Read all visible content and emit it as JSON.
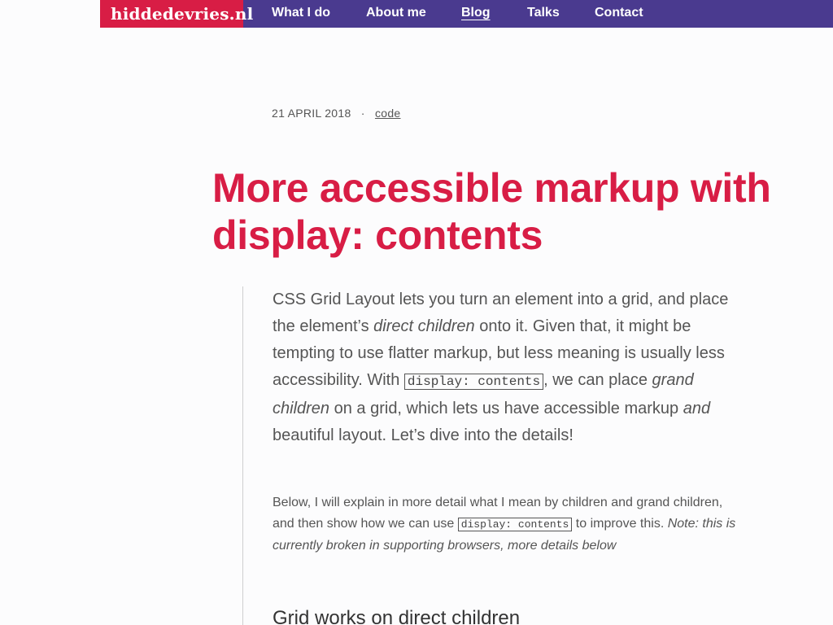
{
  "header": {
    "logo": "hiddedevries.nl",
    "nav": [
      "What I do",
      "About me",
      "Blog",
      "Talks",
      "Contact"
    ],
    "active": "Blog"
  },
  "post": {
    "date": "21 APRIL 2018",
    "separator": "·",
    "category": "code",
    "title": "More accessible markup with display: contents",
    "intro": [
      "CSS Grid Layout lets you turn an element into a grid, and place the element’s ",
      "direct children",
      " onto it. Given that, it might be tempting to use flatter markup, but less meaning is usually less accessibility. With ",
      "display: contents",
      ", we can place ",
      "grand children",
      " on a grid, which lets us have accessible markup ",
      "and",
      " beautiful layout. Let’s dive into the details!"
    ],
    "paragraph": [
      "Below, I will explain in more detail what I mean by children and grand children, and then show how we can use ",
      "display: contents",
      " to improve this. ",
      "Note: this is currently broken in supporting browsers, more details below"
    ],
    "heading2": "Grid works on direct children"
  },
  "colors": {
    "accent": "#d81d45",
    "nav_bg": "#4a3a8f"
  }
}
